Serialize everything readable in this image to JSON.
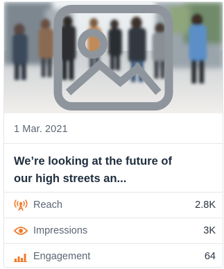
{
  "post": {
    "date": "1 Mar. 2021",
    "title_line1": "We’re looking at the future of",
    "title_line2": "our high streets an..."
  },
  "metrics": [
    {
      "label": "Reach",
      "value": "2.8K",
      "icon": "broadcast-icon"
    },
    {
      "label": "Impressions",
      "value": "3K",
      "icon": "eye-icon"
    },
    {
      "label": "Engagement",
      "value": "64",
      "icon": "bar-chart-icon"
    }
  ],
  "colors": {
    "accent": "#f07a2a",
    "text": "#1f2d3d",
    "muted": "#5c6675",
    "border": "#e6e8eb"
  }
}
